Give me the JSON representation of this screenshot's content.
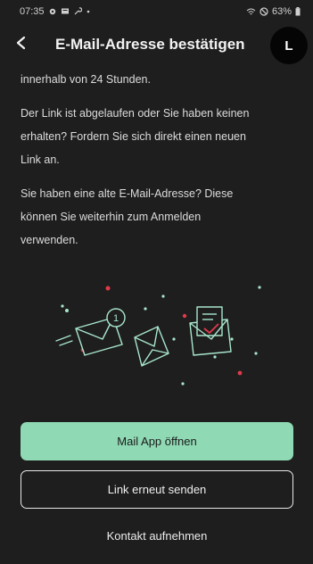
{
  "status_bar": {
    "time": "07:35",
    "battery": "63%",
    "icons": [
      "gear-icon",
      "message-icon",
      "wrench-icon",
      "dot-icon",
      "wifi-icon",
      "do-not-disturb-icon",
      "battery-icon"
    ]
  },
  "header": {
    "title": "E-Mail-Adresse bestätigen",
    "back_icon": "back-arrow-icon",
    "avatar_initial": "L"
  },
  "body": {
    "line_top": "innerhalb von 24 Stunden.",
    "para_expired_1": "Der Link ist abgelaufen oder Sie haben keinen",
    "para_expired_2": "erhalten? Fordern Sie sich direkt einen neuen",
    "para_expired_3": "Link an.",
    "para_old_1": "Sie haben eine alte E-Mail-Adresse? Diese",
    "para_old_2": "können Sie weiterhin zum Anmelden",
    "para_old_3": "verwenden."
  },
  "illustration": {
    "badge_count": "1",
    "colors": {
      "line": "#a8e6cc",
      "dot_red": "#e03a4a",
      "dot_mint": "#a8e6cc"
    }
  },
  "actions": {
    "open_mail_app": "Mail App öffnen",
    "resend_link": "Link erneut senden",
    "contact": "Kontakt aufnehmen"
  },
  "colors": {
    "background": "#1e1e1e",
    "primary_button": "#8fd9b4",
    "text": "#e6e6e6"
  }
}
